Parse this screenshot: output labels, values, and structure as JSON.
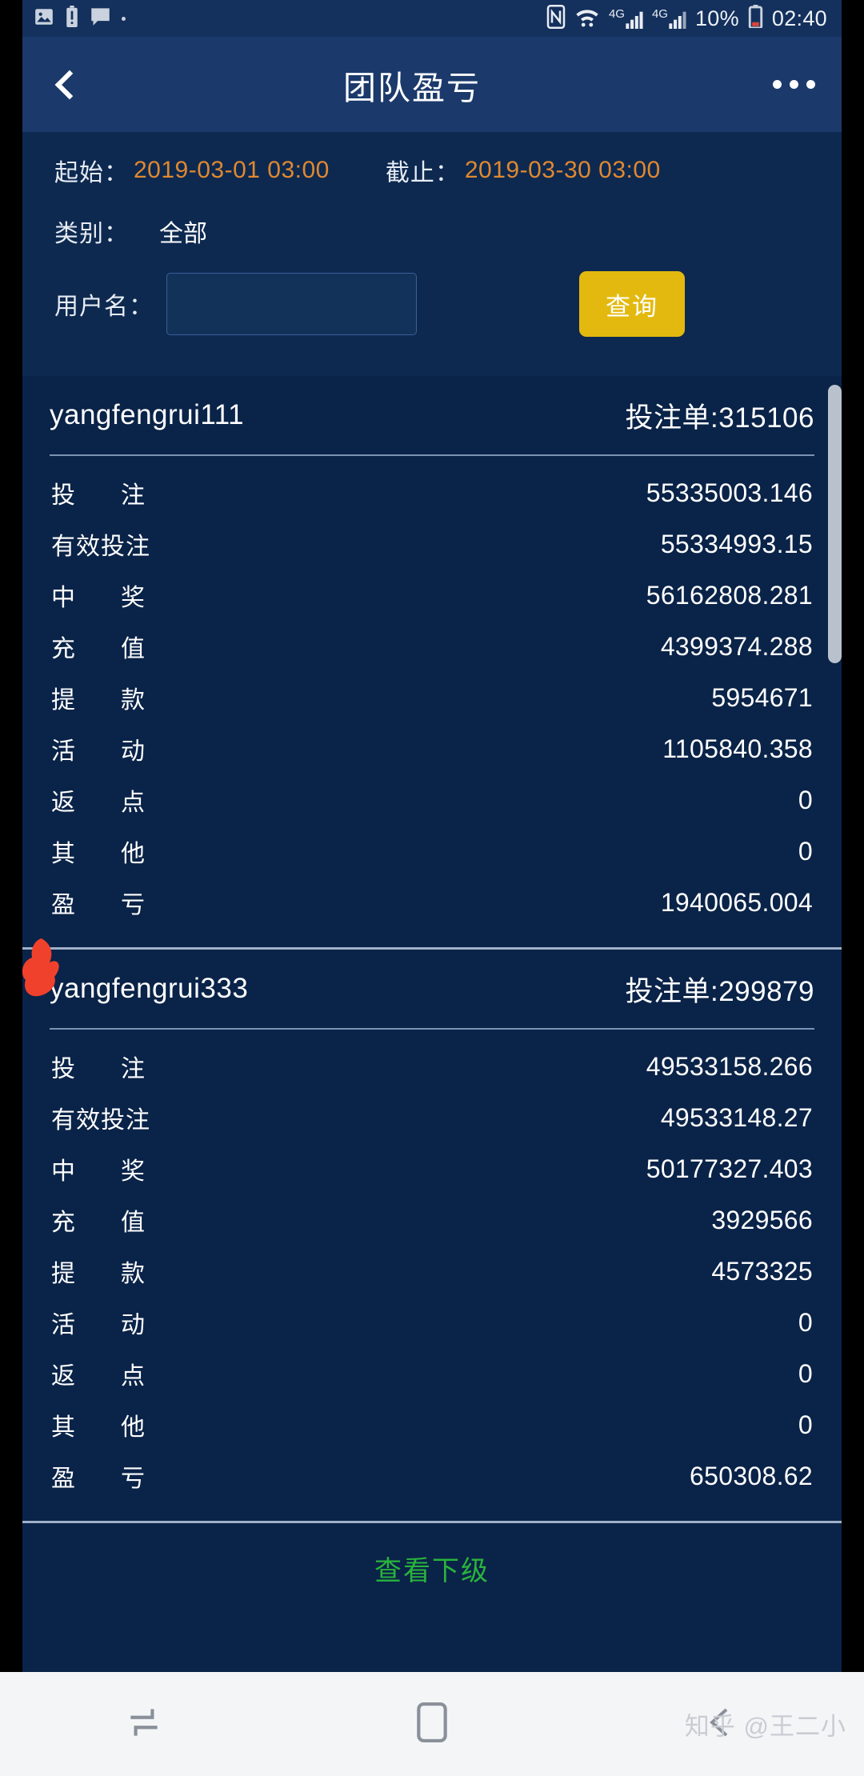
{
  "statusbar": {
    "icons_left": [
      "image-icon",
      "battery-alert-icon",
      "message-icon",
      "dot-icon"
    ],
    "nfc": "nfc-icon",
    "wifi": "wifi-icon",
    "signal_label_1": "4G",
    "signal_label_2": "4G",
    "battery_percent": "10%",
    "battery": "battery-icon",
    "time": "02:40"
  },
  "titlebar": {
    "back": "back-chevron-icon",
    "title": "团队盈亏",
    "more": "more-options-icon"
  },
  "filter": {
    "start_label": "起始：",
    "start_value": "2019-03-01 03:00",
    "end_label": "截止：",
    "end_value": "2019-03-30 03:00",
    "category_label": "类别：",
    "category_value": "全部",
    "username_label": "用户名：",
    "username_value": "",
    "username_placeholder": "",
    "query_button": "查询"
  },
  "colors": {
    "background": "#0a2348",
    "panel": "#0d2950",
    "titlebar": "#1b3a6b",
    "statusbar": "#14305c",
    "accent_orange": "#e08830",
    "accent_yellow": "#e3b90f",
    "accent_green": "#29b33c",
    "annotation_red": "#f0412c",
    "navbar": "#f4f5f7"
  },
  "cards": [
    {
      "username": "yangfengrui111",
      "orders_label": "投注单:315106",
      "annotated": false,
      "rows": [
        {
          "label": "投注",
          "spaced": true,
          "value": "55335003.146"
        },
        {
          "label": "有效投注",
          "spaced": false,
          "value": "55334993.15"
        },
        {
          "label": "中奖",
          "spaced": true,
          "value": "56162808.281"
        },
        {
          "label": "充值",
          "spaced": true,
          "value": "4399374.288"
        },
        {
          "label": "提款",
          "spaced": true,
          "value": "5954671"
        },
        {
          "label": "活动",
          "spaced": true,
          "value": "1105840.358"
        },
        {
          "label": "返点",
          "spaced": true,
          "value": "0"
        },
        {
          "label": "其他",
          "spaced": true,
          "value": "0"
        },
        {
          "label": "盈亏",
          "spaced": true,
          "value": "1940065.004"
        }
      ]
    },
    {
      "username": "yangfengrui333",
      "orders_label": "投注单:299879",
      "annotated": true,
      "rows": [
        {
          "label": "投注",
          "spaced": true,
          "value": "49533158.266"
        },
        {
          "label": "有效投注",
          "spaced": false,
          "value": "49533148.27"
        },
        {
          "label": "中奖",
          "spaced": true,
          "value": "50177327.403"
        },
        {
          "label": "充值",
          "spaced": true,
          "value": "3929566"
        },
        {
          "label": "提款",
          "spaced": true,
          "value": "4573325"
        },
        {
          "label": "活动",
          "spaced": true,
          "value": "0"
        },
        {
          "label": "返点",
          "spaced": true,
          "value": "0"
        },
        {
          "label": "其他",
          "spaced": true,
          "value": "0"
        },
        {
          "label": "盈亏",
          "spaced": true,
          "value": "650308.62"
        }
      ]
    }
  ],
  "footer": {
    "view_subordinates": "查看下级"
  },
  "navbar": {
    "recents": "recents-icon",
    "home": "home-icon",
    "back": "back-icon",
    "watermark": "知乎 @王二小"
  }
}
